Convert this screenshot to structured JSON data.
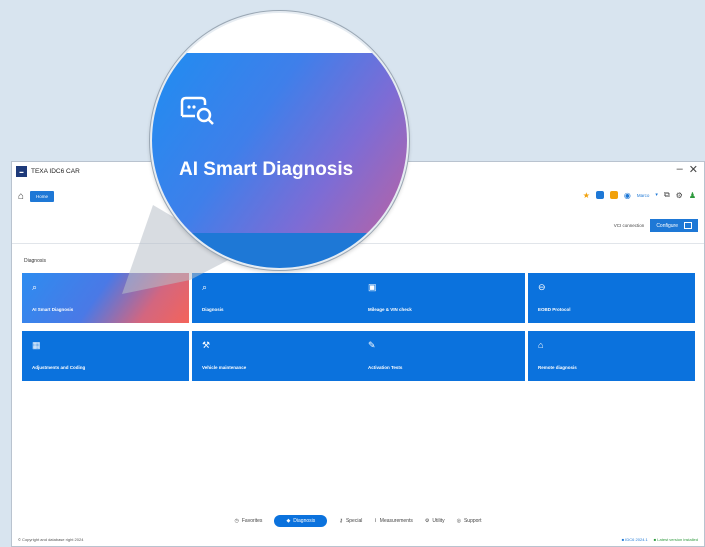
{
  "app": {
    "title": "TEXA IDC6 CAR",
    "home_tab": "Home",
    "user": "Marco",
    "vci_label": "VCI connection",
    "configure_label": "Configure"
  },
  "section": {
    "title": "Diagnosis"
  },
  "tiles": [
    {
      "label": "AI Smart Diagnosis",
      "icon": "ai-diagnosis-icon"
    },
    {
      "label": "Diagnosis",
      "icon": "diagnosis-icon"
    },
    {
      "label": "Mileage & VIN check",
      "icon": "mileage-icon"
    },
    {
      "label": "EOBD Protocol",
      "icon": "eobd-icon"
    },
    {
      "label": "Adjustments and Coding",
      "icon": "adjustments-icon"
    },
    {
      "label": "Vehicle maintenance",
      "icon": "maintenance-icon"
    },
    {
      "label": "Activation Tests",
      "icon": "activation-icon"
    },
    {
      "label": "Remote diagnosis",
      "icon": "remote-icon"
    }
  ],
  "bottom_nav": [
    {
      "label": "Favorites",
      "icon": "clock-icon",
      "active": false
    },
    {
      "label": "Diagnosis",
      "icon": "car-icon",
      "active": true
    },
    {
      "label": "Special",
      "icon": "key-icon",
      "active": false
    },
    {
      "label": "Measurements",
      "icon": "gauge-icon",
      "active": false
    },
    {
      "label": "Utility",
      "icon": "wrench-icon",
      "active": false
    },
    {
      "label": "Support",
      "icon": "support-icon",
      "active": false
    }
  ],
  "status": {
    "left": "© Copyright and database right 2024",
    "version": "IDC6 2024.1",
    "update": "Latest version installed"
  },
  "magnifier": {
    "label": "AI Smart Diagnosis"
  },
  "colors": {
    "primary": "#0b72dd",
    "gradient_start": "#2d8cf0",
    "gradient_end": "#f4645a",
    "success": "#2e9a3d"
  }
}
